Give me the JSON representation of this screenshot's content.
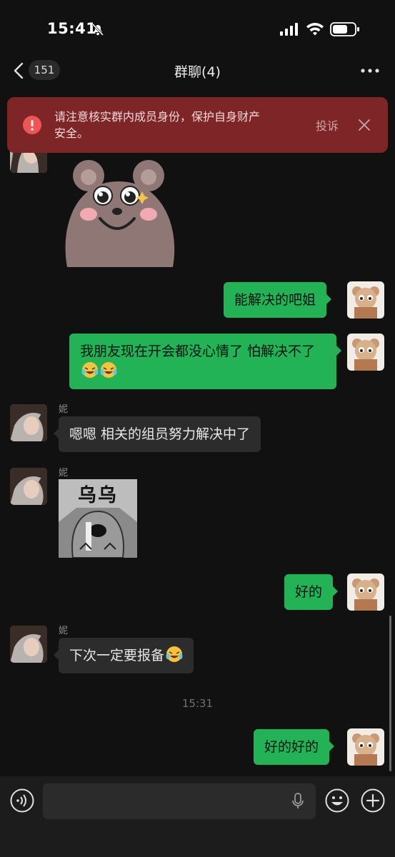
{
  "status_bar": {
    "time": "15:41"
  },
  "header": {
    "unread_count": "151",
    "title": "群聊(4)"
  },
  "warning": {
    "text": "请注意核实群内成员身份，保护自身财产安全。",
    "report_label": "投诉"
  },
  "messages": [
    {
      "side": "in",
      "type": "sticker",
      "sticker": "bear-sticker"
    },
    {
      "side": "out",
      "type": "text",
      "text": "能解决的吧姐"
    },
    {
      "side": "out",
      "type": "text",
      "text": "我朋友现在开会都没心情了 怕解决不了",
      "emojis": [
        "crying-laughing",
        "crying-laughing"
      ]
    },
    {
      "side": "in",
      "sender": "妮",
      "type": "text",
      "text": "嗯嗯 相关的组员努力解决中了"
    },
    {
      "side": "in",
      "sender": "妮",
      "type": "sticker",
      "sticker": "crying-dog-sticker",
      "sticker_text": "乌乌"
    },
    {
      "side": "out",
      "type": "text",
      "text": "好的"
    },
    {
      "side": "in",
      "sender": "妮",
      "type": "text",
      "text": "下次一定要报备",
      "emojis": [
        "crying-laughing"
      ]
    },
    {
      "type": "timestamp",
      "text": "15:31"
    },
    {
      "side": "out",
      "type": "text",
      "text": "好的好的"
    }
  ],
  "colors": {
    "background": "#111111",
    "outgoing_bubble": "#21b356",
    "incoming_bubble": "#2c2c2c",
    "warning_bg": "#7d2527"
  }
}
